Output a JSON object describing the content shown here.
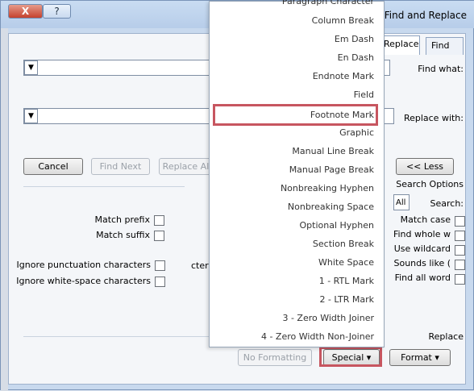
{
  "window": {
    "title": "Find and Replace",
    "close_glyph": "X",
    "help_glyph": "?"
  },
  "tabs": [
    {
      "label": "Find"
    },
    {
      "label": "Replace"
    }
  ],
  "find": {
    "label": "Find what:",
    "value": "",
    "dropdown_glyph": "▼"
  },
  "replace": {
    "label": "Replace with:",
    "value": "",
    "dropdown_glyph": "▼"
  },
  "buttons": {
    "less": "<< Less",
    "replace_all": "Replace All",
    "find_next": "Find Next",
    "cancel": "Cancel",
    "format": "Format ▾",
    "special": "Special ▾",
    "no_formatting": "No Formatting"
  },
  "search_options": {
    "heading": "Search Options",
    "search_label": "Search:",
    "search_value": "All",
    "left_options": [
      {
        "label": "Match case",
        "checked": false
      },
      {
        "label": "Find whole w",
        "checked": false
      },
      {
        "label": "Use wildcard",
        "checked": false
      },
      {
        "label": "Sounds like (",
        "checked": false
      },
      {
        "label": "Find all word",
        "checked": false
      }
    ],
    "right_options": [
      {
        "label": "Match prefix",
        "checked": false
      },
      {
        "label": "Match suffix",
        "checked": false
      }
    ],
    "ignore_options": [
      {
        "label": "Ignore punctuation characters",
        "checked": false
      },
      {
        "label": "Ignore white-space characters",
        "checked": false
      }
    ],
    "partial_text": "cters"
  },
  "replace_section": {
    "heading": "Replace"
  },
  "special_menu": {
    "items": [
      {
        "label": "Paragraph Character",
        "highlight": false
      },
      {
        "label": "Column Break",
        "highlight": false
      },
      {
        "label": "Em Dash",
        "highlight": false
      },
      {
        "label": "En Dash",
        "highlight": false
      },
      {
        "label": "Endnote Mark",
        "highlight": false
      },
      {
        "label": "Field",
        "highlight": false
      },
      {
        "label": "Footnote Mark",
        "highlight": true
      },
      {
        "label": "Graphic",
        "highlight": false
      },
      {
        "label": "Manual Line Break",
        "highlight": false
      },
      {
        "label": "Manual Page Break",
        "highlight": false
      },
      {
        "label": "Nonbreaking Hyphen",
        "highlight": false
      },
      {
        "label": "Nonbreaking Space",
        "highlight": false
      },
      {
        "label": "Optional Hyphen",
        "highlight": false
      },
      {
        "label": "Section Break",
        "highlight": false
      },
      {
        "label": "White Space",
        "highlight": false
      },
      {
        "label": "1 - RTL Mark",
        "highlight": false
      },
      {
        "label": "2 - LTR Mark",
        "highlight": false
      },
      {
        "label": "3 - Zero Width Joiner",
        "highlight": false
      },
      {
        "label": "4 - Zero Width Non-Joiner",
        "highlight": false
      }
    ]
  },
  "colors": {
    "highlight_border": "#c75660",
    "title_bar": "#c9dcf2"
  }
}
